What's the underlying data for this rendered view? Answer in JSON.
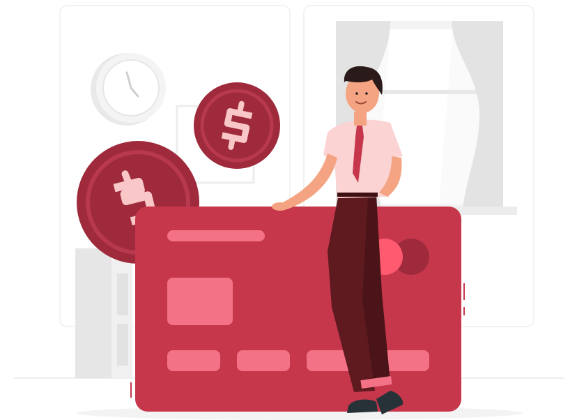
{
  "illustration": {
    "subject": "man-leaning-on-credit-card-with-coins",
    "colors": {
      "card": "#c6374c",
      "card_accent": "#f47285",
      "coin": "#9e2a3c",
      "coin_rim": "#b8384c",
      "coin_symbol": "#f9c7c7",
      "shirt": "#fbd3d3",
      "tie": "#c6374c",
      "trousers": "#5e1a1f",
      "skin": "#f4a482",
      "hair": "#2b1a1a",
      "shoes": "#263238",
      "background_shapes": "#ececec",
      "background_frames": "#f5f5f5"
    },
    "icons": [
      "clock-icon",
      "dollar-coin-icon",
      "credit-card",
      "window-with-curtains"
    ]
  }
}
